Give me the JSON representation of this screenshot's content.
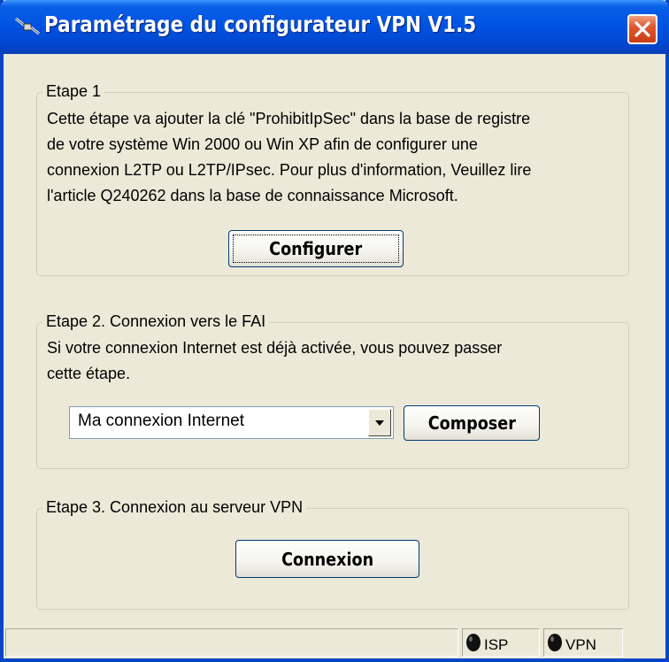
{
  "window": {
    "title": "Paramétrage du configurateur VPN V1.5",
    "close_icon": "close-icon",
    "app_icon": "network-cable-icon"
  },
  "step1": {
    "legend": "Etape 1",
    "lines": [
      "Cette étape va ajouter la clé \"ProhibitIpSec\" dans la base de registre",
      "de votre système Win 2000 ou Win XP afin de configurer une",
      "connexion L2TP ou L2TP/IPsec. Pour plus d'information, Veuillez lire",
      "l'article Q240262 dans la base de connaissance Microsoft."
    ],
    "button_label": "Configurer"
  },
  "step2": {
    "legend": "Etape 2. Connexion vers le FAI",
    "lines": [
      "Si votre connexion Internet est déjà activée, vous pouvez passer",
      "cette étape."
    ],
    "combo_value": "Ma connexion Internet",
    "button_label": "Composer"
  },
  "step3": {
    "legend": "Etape 3. Connexion au serveur VPN",
    "button_label": "Connexion"
  },
  "status": {
    "isp_label": "ISP",
    "vpn_label": "VPN",
    "isp_icon": "status-led-icon",
    "vpn_icon": "status-led-icon"
  },
  "colors": {
    "titlebar": "#0054e3",
    "face": "#ece9d8",
    "close_button": "#e2582e",
    "led": "#101010"
  }
}
